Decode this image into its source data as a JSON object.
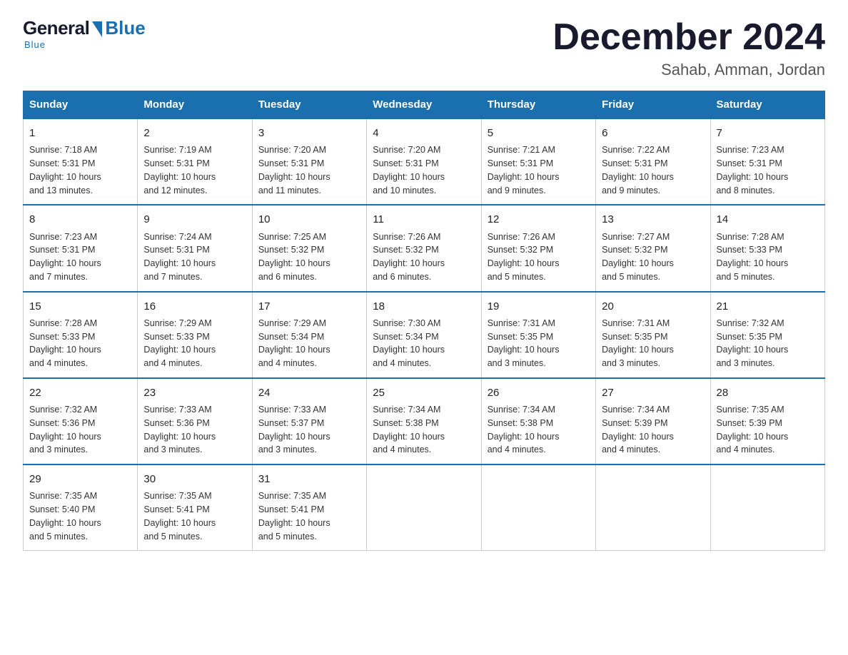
{
  "logo": {
    "general": "General",
    "blue": "Blue"
  },
  "title": "December 2024",
  "subtitle": "Sahab, Amman, Jordan",
  "headers": [
    "Sunday",
    "Monday",
    "Tuesday",
    "Wednesday",
    "Thursday",
    "Friday",
    "Saturday"
  ],
  "weeks": [
    [
      {
        "day": "1",
        "sunrise": "7:18 AM",
        "sunset": "5:31 PM",
        "daylight": "10 hours and 13 minutes."
      },
      {
        "day": "2",
        "sunrise": "7:19 AM",
        "sunset": "5:31 PM",
        "daylight": "10 hours and 12 minutes."
      },
      {
        "day": "3",
        "sunrise": "7:20 AM",
        "sunset": "5:31 PM",
        "daylight": "10 hours and 11 minutes."
      },
      {
        "day": "4",
        "sunrise": "7:20 AM",
        "sunset": "5:31 PM",
        "daylight": "10 hours and 10 minutes."
      },
      {
        "day": "5",
        "sunrise": "7:21 AM",
        "sunset": "5:31 PM",
        "daylight": "10 hours and 9 minutes."
      },
      {
        "day": "6",
        "sunrise": "7:22 AM",
        "sunset": "5:31 PM",
        "daylight": "10 hours and 9 minutes."
      },
      {
        "day": "7",
        "sunrise": "7:23 AM",
        "sunset": "5:31 PM",
        "daylight": "10 hours and 8 minutes."
      }
    ],
    [
      {
        "day": "8",
        "sunrise": "7:23 AM",
        "sunset": "5:31 PM",
        "daylight": "10 hours and 7 minutes."
      },
      {
        "day": "9",
        "sunrise": "7:24 AM",
        "sunset": "5:31 PM",
        "daylight": "10 hours and 7 minutes."
      },
      {
        "day": "10",
        "sunrise": "7:25 AM",
        "sunset": "5:32 PM",
        "daylight": "10 hours and 6 minutes."
      },
      {
        "day": "11",
        "sunrise": "7:26 AM",
        "sunset": "5:32 PM",
        "daylight": "10 hours and 6 minutes."
      },
      {
        "day": "12",
        "sunrise": "7:26 AM",
        "sunset": "5:32 PM",
        "daylight": "10 hours and 5 minutes."
      },
      {
        "day": "13",
        "sunrise": "7:27 AM",
        "sunset": "5:32 PM",
        "daylight": "10 hours and 5 minutes."
      },
      {
        "day": "14",
        "sunrise": "7:28 AM",
        "sunset": "5:33 PM",
        "daylight": "10 hours and 5 minutes."
      }
    ],
    [
      {
        "day": "15",
        "sunrise": "7:28 AM",
        "sunset": "5:33 PM",
        "daylight": "10 hours and 4 minutes."
      },
      {
        "day": "16",
        "sunrise": "7:29 AM",
        "sunset": "5:33 PM",
        "daylight": "10 hours and 4 minutes."
      },
      {
        "day": "17",
        "sunrise": "7:29 AM",
        "sunset": "5:34 PM",
        "daylight": "10 hours and 4 minutes."
      },
      {
        "day": "18",
        "sunrise": "7:30 AM",
        "sunset": "5:34 PM",
        "daylight": "10 hours and 4 minutes."
      },
      {
        "day": "19",
        "sunrise": "7:31 AM",
        "sunset": "5:35 PM",
        "daylight": "10 hours and 3 minutes."
      },
      {
        "day": "20",
        "sunrise": "7:31 AM",
        "sunset": "5:35 PM",
        "daylight": "10 hours and 3 minutes."
      },
      {
        "day": "21",
        "sunrise": "7:32 AM",
        "sunset": "5:35 PM",
        "daylight": "10 hours and 3 minutes."
      }
    ],
    [
      {
        "day": "22",
        "sunrise": "7:32 AM",
        "sunset": "5:36 PM",
        "daylight": "10 hours and 3 minutes."
      },
      {
        "day": "23",
        "sunrise": "7:33 AM",
        "sunset": "5:36 PM",
        "daylight": "10 hours and 3 minutes."
      },
      {
        "day": "24",
        "sunrise": "7:33 AM",
        "sunset": "5:37 PM",
        "daylight": "10 hours and 3 minutes."
      },
      {
        "day": "25",
        "sunrise": "7:34 AM",
        "sunset": "5:38 PM",
        "daylight": "10 hours and 4 minutes."
      },
      {
        "day": "26",
        "sunrise": "7:34 AM",
        "sunset": "5:38 PM",
        "daylight": "10 hours and 4 minutes."
      },
      {
        "day": "27",
        "sunrise": "7:34 AM",
        "sunset": "5:39 PM",
        "daylight": "10 hours and 4 minutes."
      },
      {
        "day": "28",
        "sunrise": "7:35 AM",
        "sunset": "5:39 PM",
        "daylight": "10 hours and 4 minutes."
      }
    ],
    [
      {
        "day": "29",
        "sunrise": "7:35 AM",
        "sunset": "5:40 PM",
        "daylight": "10 hours and 5 minutes."
      },
      {
        "day": "30",
        "sunrise": "7:35 AM",
        "sunset": "5:41 PM",
        "daylight": "10 hours and 5 minutes."
      },
      {
        "day": "31",
        "sunrise": "7:35 AM",
        "sunset": "5:41 PM",
        "daylight": "10 hours and 5 minutes."
      },
      null,
      null,
      null,
      null
    ]
  ],
  "labels": {
    "sunrise": "Sunrise:",
    "sunset": "Sunset:",
    "daylight": "Daylight:"
  }
}
